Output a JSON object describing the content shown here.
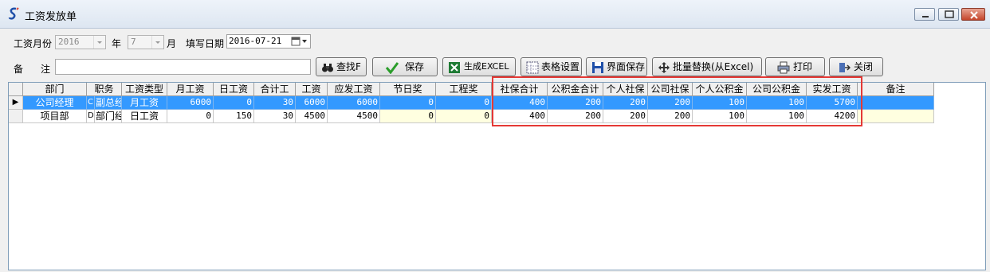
{
  "window": {
    "title": "工资发放单"
  },
  "form": {
    "month_label": "工资月份",
    "year_value": "2016",
    "year_label": "年",
    "month_value": "7",
    "month_unit": "月",
    "date_label": "填写日期",
    "date_value": "2016-07-21",
    "remark_label_a": "备",
    "remark_label_b": "注",
    "remark_value": ""
  },
  "toolbar": {
    "find": "查找F",
    "save": "保存",
    "excel": "生成EXCEL",
    "table_settings": "表格设置",
    "save_layout": "界面保存",
    "batch_replace": "批量替换(从Excel)",
    "print": "打印",
    "close": "关闭"
  },
  "grid": {
    "columns": [
      "部门",
      "职务",
      "工资类型",
      "月工资",
      "日工资",
      "合计工",
      "工资",
      "应发工资",
      "节日奖",
      "工程奖",
      "社保合计",
      "公积金合计",
      "个人社保",
      "公司社保",
      "个人公积金",
      "公司公积金",
      "实发工资",
      "备注"
    ],
    "rows": [
      {
        "indicator": "▶",
        "dept": "公司经理",
        "code": "C",
        "post": "副总经",
        "type": "月工资",
        "monthly": "6000",
        "daily": "0",
        "days": "30",
        "wage": "6000",
        "gross": "6000",
        "festival": "0",
        "project": "0",
        "social_total": "400",
        "fund_total": "200",
        "social_personal": "200",
        "social_company": "200",
        "fund_personal": "100",
        "fund_company": "100",
        "net": "5700",
        "remark": ""
      },
      {
        "indicator": "",
        "dept": "项目部",
        "code": "D",
        "post": "部门经",
        "type": "日工资",
        "monthly": "0",
        "daily": "150",
        "days": "30",
        "wage": "4500",
        "gross": "4500",
        "festival": "0",
        "project": "0",
        "social_total": "400",
        "fund_total": "200",
        "social_personal": "200",
        "social_company": "200",
        "fund_personal": "100",
        "fund_company": "100",
        "net": "4200",
        "remark": ""
      }
    ]
  },
  "colors": {
    "selection": "#3399ff",
    "highlight_box": "#e53935",
    "editable_cell": "#ffffe0"
  }
}
